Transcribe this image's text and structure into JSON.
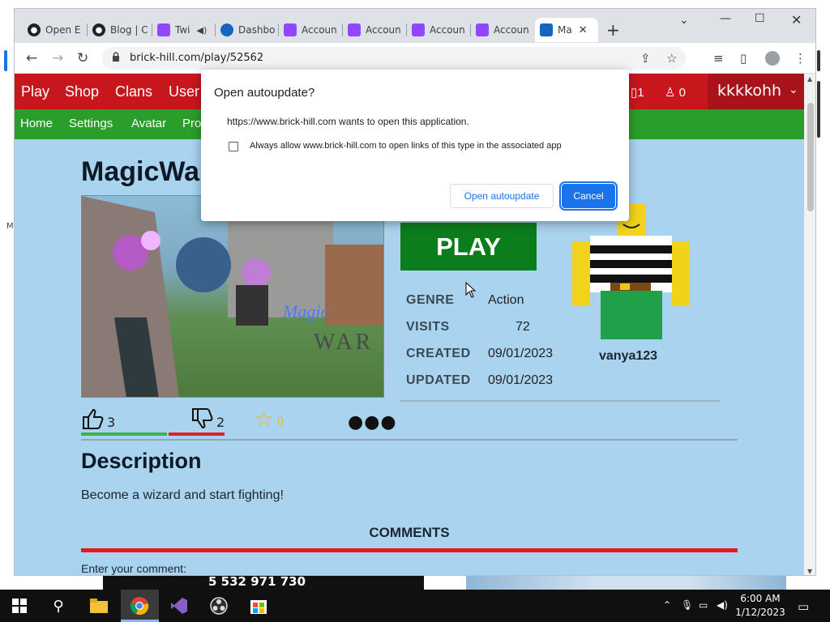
{
  "desktop": {
    "left_char": "M"
  },
  "browser": {
    "tabs": [
      {
        "label": "Open E",
        "icon": "obs-icon",
        "color": "#222222"
      },
      {
        "label": "Blog | C",
        "icon": "obs-icon",
        "color": "#222222"
      },
      {
        "label": "Twi",
        "icon": "twitch-icon",
        "color": "#9146ff"
      },
      {
        "label": "Dashbo",
        "icon": "dashboard-icon",
        "color": "#1565c0"
      },
      {
        "label": "Accoun",
        "icon": "twitch-icon",
        "color": "#9146ff"
      },
      {
        "label": "Accoun",
        "icon": "twitch-icon",
        "color": "#9146ff"
      },
      {
        "label": "Accoun",
        "icon": "twitch-icon",
        "color": "#9146ff"
      },
      {
        "label": "Accoun",
        "icon": "twitch-icon",
        "color": "#9146ff"
      },
      {
        "label": "Ma",
        "icon": "brick-hill-icon",
        "color": "#1565c0",
        "active": true
      }
    ],
    "url": "brick-hill.com/play/52562"
  },
  "site": {
    "topnav": [
      "Play",
      "Shop",
      "Clans",
      "User"
    ],
    "notif_count": "1",
    "friends_count": "0",
    "username": "kkkkohh",
    "subnav": [
      "Home",
      "Settings",
      "Avatar",
      "Pro"
    ]
  },
  "game": {
    "title": "MagicWa",
    "thumbnail_text": "WAR",
    "play_label": "PLAY",
    "info": {
      "genre_label": "GENRE",
      "genre": "Action",
      "visits_label": "VISITS",
      "visits": "72",
      "created_label": "CREATED",
      "created": "09/01/2023",
      "updated_label": "UPDATED",
      "updated": "09/01/2023"
    },
    "creator": "vanya123",
    "likes": "3",
    "dislikes": "2",
    "favorites": "0",
    "description_heading": "Description",
    "description": "Become a wizard and start fighting!",
    "comments_heading": "COMMENTS",
    "comment_prompt": "Enter your comment:"
  },
  "dialog": {
    "title": "Open autoupdate?",
    "message": "https://www.brick-hill.com wants to open this application.",
    "checkbox_label": "Always allow www.brick-hill.com to open links of this type in the associated app",
    "open_label": "Open autoupdate",
    "cancel_label": "Cancel"
  },
  "background_ghost": {
    "number": "5 532 971 730",
    "cancel": "Cancel"
  },
  "taskbar": {
    "time": "6:00 AM",
    "date": "1/12/2023"
  }
}
